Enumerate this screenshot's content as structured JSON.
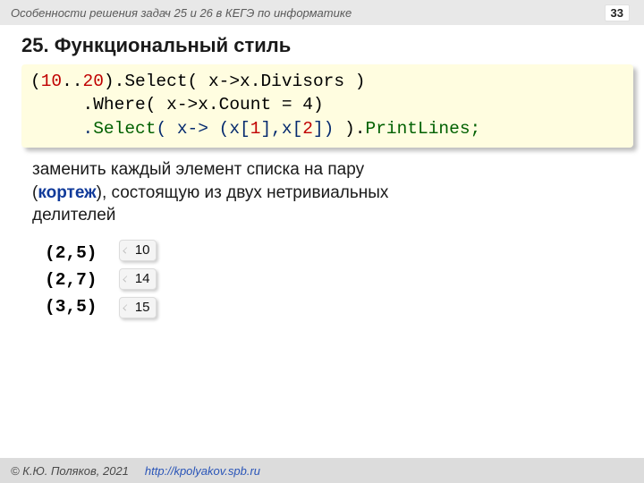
{
  "header": {
    "title": "Особенности решения задач 25 и 26 в КЕГЭ по информатике",
    "page": "33"
  },
  "title": "25. Функциональный стиль",
  "code": {
    "l1_a": "(",
    "l1_b": "10",
    "l1_c": "..",
    "l1_d": "20",
    "l1_e": ").Select( x->x.Divisors )",
    "l2": "     .Where( x->x.Count = 4)",
    "l3_a": "     ",
    "l3_b": ".",
    "l3_c": "Select",
    "l3_d": "( x-> ",
    "l3_e": "(x[",
    "l3_f": "1",
    "l3_g": "],x[",
    "l3_h": "2",
    "l3_i": "])",
    "l3_j": " ).",
    "l3_k": "PrintLines;"
  },
  "body": {
    "line1": "заменить каждый элемент списка на пару",
    "line2_a": "(",
    "line2_term": "кортеж",
    "line2_b": "), состоящую из двух нетривиальных",
    "line3": "делителей"
  },
  "tuples": [
    "(2,5)",
    "(2,7)",
    "(3,5)"
  ],
  "badges": [
    "10",
    "14",
    "15"
  ],
  "footer": {
    "copyright": "© К.Ю. Поляков, 2021",
    "url": "http://kpolyakov.spb.ru"
  }
}
